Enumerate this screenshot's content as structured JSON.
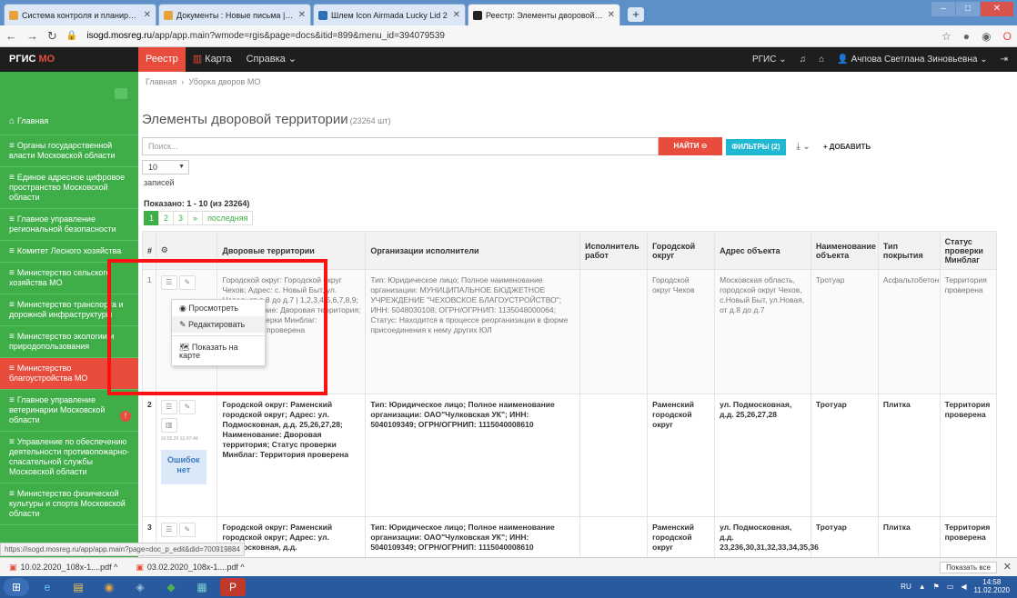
{
  "browser": {
    "tabs": [
      {
        "title": "Система контроля и планирован",
        "color": "#e8a23c",
        "active": false
      },
      {
        "title": "Документы : Новые письма | Зи",
        "color": "#e8a23c",
        "active": false
      },
      {
        "title": "Шлем Icon Airmada Lucky Lid 2",
        "color": "#2f6fb5",
        "active": false
      },
      {
        "title": "Реестр: Элементы дворовой тер",
        "color": "#222222",
        "active": true
      }
    ],
    "url_domain": "isogd.mosreg.ru",
    "url_path": "/app/app.main?wmode=rgis&page=docs&itid=899&menu_id=394079539"
  },
  "header": {
    "brand_main": "РГИС",
    "brand_suffix": " МО",
    "nav": [
      {
        "label": "Реестр",
        "active": true
      },
      {
        "label": "Карта"
      },
      {
        "label": "Справка ⌄"
      }
    ],
    "right_rgis": "РГИС ⌄",
    "user": "Ачпова Светлана Зиновьевна ⌄"
  },
  "sidebar": {
    "items": [
      {
        "label": "Главная",
        "icon": "home"
      },
      {
        "label": "Органы государственной власти Московской области"
      },
      {
        "label": "Единое адресное цифровое пространство Московской области"
      },
      {
        "label": "Главное управление региональной безопасности"
      },
      {
        "label": "Комитет Лесного хозяйства"
      },
      {
        "label": "Министерство сельского хозяйства МО"
      },
      {
        "label": "Министерство транспорта и дорожной инфраструктуры"
      },
      {
        "label": "Министерство экологии и природопользования"
      },
      {
        "label": "Министерство благоустройства МО",
        "active": true
      },
      {
        "label": "Главное управление ветеринарии Московской области",
        "badge": "!"
      },
      {
        "label": "Управление по обеспечению деятельности противопожарно-спасательной службы Московской области"
      },
      {
        "label": "Министерство физической культуры и спорта Московской области"
      }
    ]
  },
  "main": {
    "breadcrumb": [
      "Главная",
      "Уборка дворов МО"
    ],
    "title": "Элементы дворовой территории",
    "count": "(23264 шт)",
    "search_placeholder": "Поиск...",
    "find_label": "НАЙТИ ⊖",
    "filters_label": "ФИЛЬТРЫ (2)",
    "download_label": "⤓ ⌄",
    "add_label": "+ ДОБАВИТЬ",
    "per_page_value": "10",
    "per_page_label": "записей",
    "shown_label": "Показано: 1 - 10 (из 23264)",
    "pager": [
      "1",
      "2",
      "3",
      "»",
      "последняя"
    ]
  },
  "table": {
    "columns": [
      "#",
      "⚙",
      "Дворовые территории",
      "Организации исполнители",
      "Исполнитель работ",
      "Городской округ",
      "Адрес объекта",
      "Наименование объекта",
      "Тип покрытия",
      "Статус проверки Минблаг"
    ],
    "rows": [
      {
        "num": "1",
        "desc": "Городской округ: Городской округ Чехов; Адрес: с. Новый Быт, ул. Новая, от д.8 до д.7 | 1,2,3,4,5,6,7,8,9; Наименование: Дворовая территория; Статус проверки Минблаг: Территория проверена",
        "org": "Тип: Юридическое лицо; Полное наименование организации: МУНИЦИПАЛЬНОЕ БЮДЖЕТНОЕ УЧРЕЖДЕНИЕ \"ЧЕХОВСКОЕ БЛАГОУСТРОЙСТВО\"; ИНН: 5048030108; ОГРН/ОГРНИП: 1135048000064; Статус: Находится в процессе реорганизации в форме присоединения к нему других ЮЛ",
        "executor": "",
        "district": "Городской округ Чехов",
        "address": "Московская область, городской округ Чехов, с.Новый Быт, ул.Новая, от д.8 до д.7",
        "name": "Тротуар",
        "cover": "Асфальтобетон",
        "status": "Территория проверена"
      },
      {
        "num": "2",
        "desc": "Городской округ: Раменский городской округ; Адрес: ул. Подмосковная, д.д. 25,26,27,28; Наименование: Дворовая территория; Статус проверки Минблаг: Территория проверена",
        "org": "Тип: Юридическое лицо; Полное наименование организации: ОАО\"Чулковская УК\"; ИНН: 5040109349; ОГРН/ОГРНИП: 1115040008610",
        "executor": "",
        "district": "Раменский городской округ",
        "address": "ул. Подмосковная, д.д. 25,26,27,28",
        "name": "Тротуар",
        "cover": "Плитка",
        "status": "Территория проверена",
        "error_label": "Ошибок нет",
        "tiny": "10.02.20 12:07:44"
      },
      {
        "num": "3",
        "desc": "Городской округ: Раменский городской округ; Адрес: ул. Подмосковная, д.д.",
        "org": "Тип: Юридическое лицо; Полное наименование организации: ОАО\"Чулковская УК\"; ИНН: 5040109349; ОГРН/ОГРНИП: 1115040008610",
        "executor": "",
        "district": "Раменский городской округ",
        "address": "ул. Подмосковная, д.д. 23,236,30,31,32,33,34,35,36",
        "name": "Тротуар",
        "cover": "Плитка",
        "status": "Территория проверена"
      }
    ]
  },
  "context_menu": {
    "view": "◉ Просмотреть",
    "edit": "✎ Редактировать",
    "show_map": "🗺 Показать на карте"
  },
  "status_url": "https://isogd.mosreg.ru/app/app.main?page=doc_p_edit&did=700919884",
  "downloads": {
    "items": [
      "10.02.2020_108х-1....pdf ^",
      "03.02.2020_108х-1....pdf ^"
    ],
    "show_all": "Показать все"
  },
  "taskbar": {
    "lang": "RU",
    "time": "14:58",
    "date": "11.02.2020"
  },
  "colors": {
    "accent_red": "#e74c3c",
    "sidebar_green": "#3fae49",
    "filter_cyan": "#21b8d4"
  }
}
